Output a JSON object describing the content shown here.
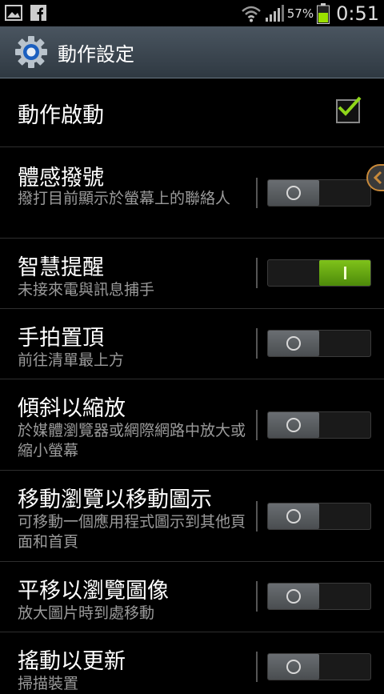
{
  "statusbar": {
    "battery_percent": "57%",
    "time": "0:51",
    "icons": [
      "gallery-icon",
      "facebook-icon",
      "wifi-icon",
      "signal-icon",
      "battery-icon"
    ]
  },
  "header": {
    "title": "動作設定",
    "icon": "gear-icon"
  },
  "settings": [
    {
      "label": "動作啟動",
      "type": "checkbox",
      "checked": true
    },
    {
      "label": "體感撥號",
      "summary": "撥打目前顯示於螢幕上的聯絡人",
      "type": "toggle",
      "on": false
    },
    {
      "label": "智慧提醒",
      "summary": "未接來電與訊息捕手",
      "type": "toggle",
      "on": true
    },
    {
      "label": "手拍置頂",
      "summary": "前往清單最上方",
      "type": "toggle",
      "on": false
    },
    {
      "label": "傾斜以縮放",
      "summary": "於媒體瀏覽器或網際網路中放大或縮小螢幕",
      "type": "toggle",
      "on": false
    },
    {
      "label": "移動瀏覽以移動圖示",
      "summary": "可移動一個應用程式圖示到其他頁面和首頁",
      "type": "toggle",
      "on": false
    },
    {
      "label": "平移以瀏覽圖像",
      "summary": "放大圖片時到處移動",
      "type": "toggle",
      "on": false
    },
    {
      "label": "搖動以更新",
      "summary": "掃描裝置",
      "type": "toggle",
      "on": false
    }
  ],
  "colors": {
    "accent_green": "#7fc21a",
    "titlebar": "#3c4650"
  }
}
